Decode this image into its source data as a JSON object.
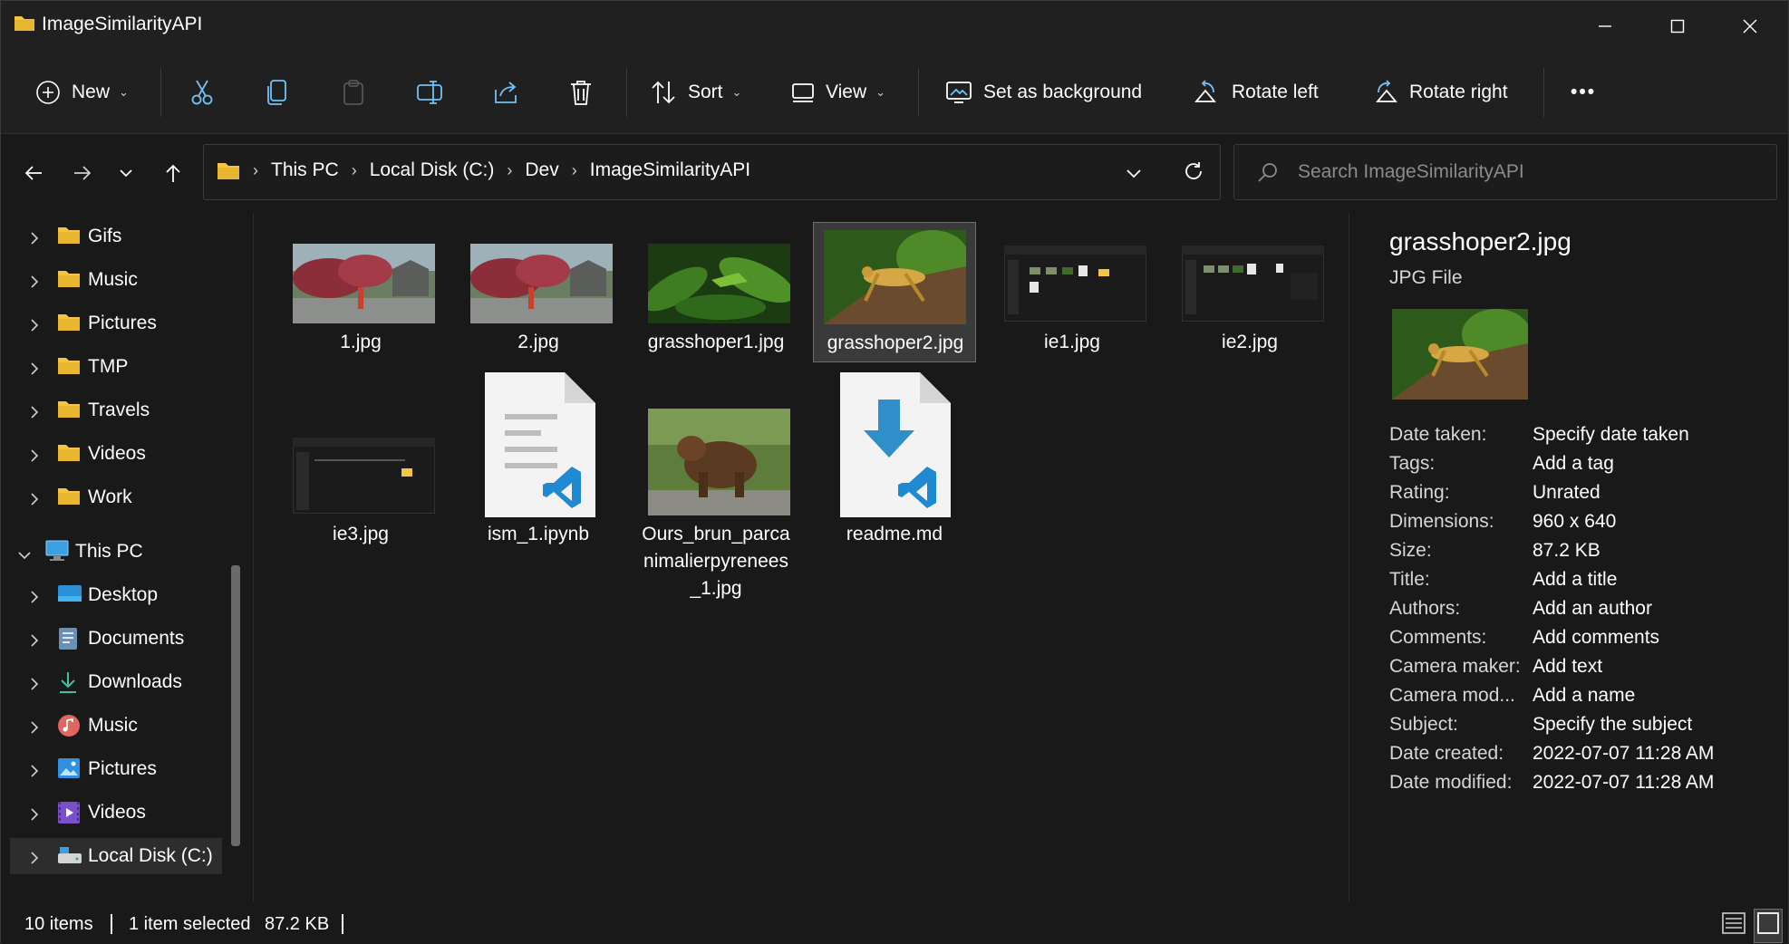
{
  "window": {
    "title": "ImageSimilarityAPI"
  },
  "toolbar": {
    "new_label": "New",
    "sort_label": "Sort",
    "view_label": "View",
    "set_background_label": "Set as background",
    "rotate_left_label": "Rotate left",
    "rotate_right_label": "Rotate right",
    "more_label": "•••"
  },
  "breadcrumb": [
    "This PC",
    "Local Disk (C:)",
    "Dev",
    "ImageSimilarityAPI"
  ],
  "search": {
    "placeholder": "Search ImageSimilarityAPI"
  },
  "nav": {
    "quick": [
      "Gifs",
      "Music",
      "Pictures",
      "TMP",
      "Travels",
      "Videos",
      "Work"
    ],
    "this_pc": "This PC",
    "pc_items": [
      "Desktop",
      "Documents",
      "Downloads",
      "Music",
      "Pictures",
      "Videos",
      "Local Disk (C:)"
    ]
  },
  "files": [
    {
      "name": "1.jpg"
    },
    {
      "name": "2.jpg"
    },
    {
      "name": "grasshoper1.jpg"
    },
    {
      "name": "grasshoper2.jpg"
    },
    {
      "name": "ie1.jpg"
    },
    {
      "name": "ie2.jpg"
    },
    {
      "name": "ie3.jpg"
    },
    {
      "name": "ism_1.ipynb"
    },
    {
      "name_line1": "Ours_brun_parca",
      "name_line2": "nimalierpyrenees",
      "name_line3": "_1.jpg"
    },
    {
      "name": "readme.md"
    }
  ],
  "details": {
    "name": "grasshoper2.jpg",
    "type": "JPG File",
    "props": [
      {
        "k": "Date taken:",
        "v": "Specify date taken"
      },
      {
        "k": "Tags:",
        "v": "Add a tag"
      },
      {
        "k": "Rating:",
        "v": "Unrated"
      },
      {
        "k": "Dimensions:",
        "v": "960 x 640"
      },
      {
        "k": "Size:",
        "v": "87.2 KB"
      },
      {
        "k": "Title:",
        "v": "Add a title"
      },
      {
        "k": "Authors:",
        "v": "Add an author"
      },
      {
        "k": "Comments:",
        "v": "Add comments"
      },
      {
        "k": "Camera maker:",
        "v": "Add text"
      },
      {
        "k": "Camera mod...",
        "v": "Add a name"
      },
      {
        "k": "Subject:",
        "v": "Specify the subject"
      },
      {
        "k": "Date created:",
        "v": "2022-07-07 11:28 AM"
      },
      {
        "k": "Date modified:",
        "v": "2022-07-07 11:28 AM"
      }
    ]
  },
  "status": {
    "items": "10 items",
    "selected": "1 item selected",
    "size": "87.2 KB"
  },
  "colors": {
    "folder": "#f4c542",
    "accent": "#4cc2ff",
    "vscode": "#1f8ad2",
    "background": "#191919"
  }
}
